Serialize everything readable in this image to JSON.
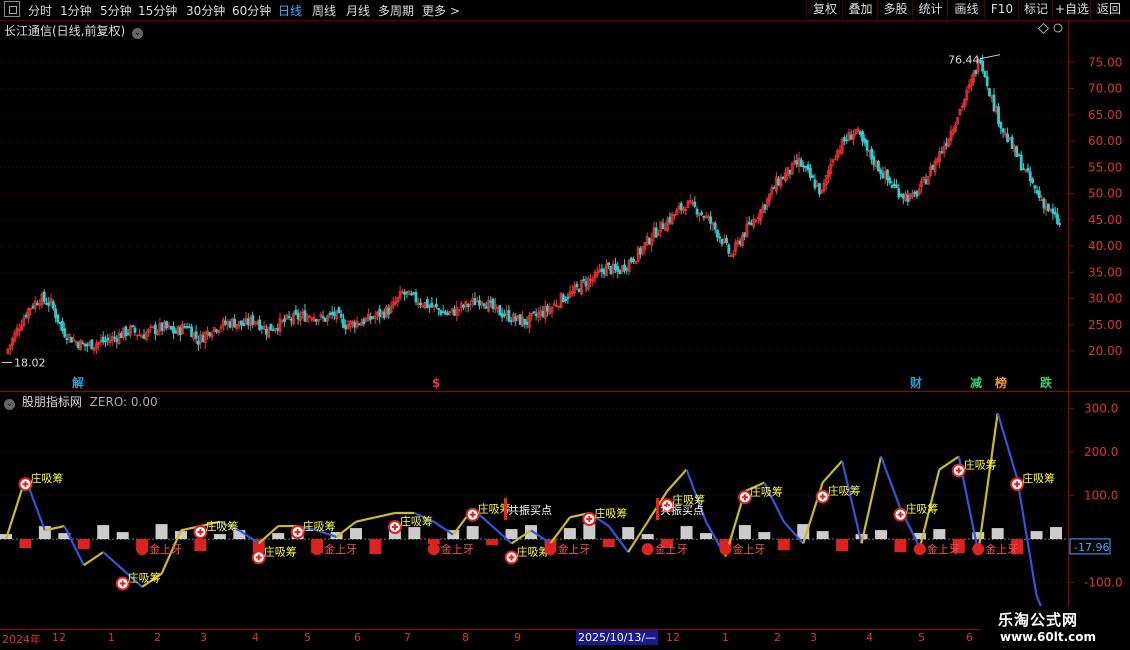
{
  "toolbar": {
    "items": [
      "分时",
      "1分钟",
      "5分钟",
      "15分钟",
      "30分钟",
      "60分钟",
      "日线",
      "周线",
      "月线",
      "多周期",
      "更多 >"
    ],
    "active_index": 6,
    "right_items": [
      "复权",
      "叠加",
      "多股",
      "统计",
      "画线",
      "F10",
      "标记",
      "+自选",
      "返回"
    ]
  },
  "main_chart": {
    "title": "长江通信(日线,前复权)",
    "price_high_label": "76.44",
    "price_low_label": "18.02",
    "y_ticks": [
      "75.00",
      "70.00",
      "65.00",
      "60.00",
      "55.00",
      "50.00",
      "45.00",
      "40.00",
      "35.00",
      "30.00",
      "25.00",
      "20.00"
    ],
    "markers": [
      {
        "text": "解",
        "color": "#39c"
      },
      {
        "text": "$",
        "color": "#e33"
      },
      {
        "text": "财",
        "color": "#39c"
      },
      {
        "text": "减",
        "color": "#3c7"
      },
      {
        "text": "榜",
        "color": "#e93"
      },
      {
        "text": "跌",
        "color": "#3c7"
      }
    ]
  },
  "indicator": {
    "title": "股朋指标网",
    "zero_label": "ZERO: 0.00",
    "current_value": "-17.96",
    "y_ticks": [
      "300.0",
      "200.0",
      "100.0",
      "-100.0"
    ],
    "labels": {
      "accumulate": "庄吸筹",
      "gold_bud": "金上牙",
      "bottom_point": "共振买点"
    }
  },
  "chart_data": {
    "type": "candlestick",
    "title": "长江通信(日线,前复权)",
    "ylim": [
      16,
      80
    ],
    "high": 76.44,
    "low": 18.02,
    "close_series_approx": [
      19.5,
      24,
      28,
      30,
      29,
      24,
      22,
      21,
      21.5,
      22,
      23,
      24,
      23,
      24,
      24.5,
      23.5,
      25,
      22,
      24,
      25,
      25.5,
      25,
      26,
      24,
      25,
      26,
      26.5,
      27,
      26,
      27,
      25,
      25.5,
      26,
      27,
      28,
      31,
      30,
      29,
      28,
      27,
      28,
      29,
      30,
      28,
      27,
      26,
      25.5,
      27,
      28,
      30,
      31,
      33,
      34,
      36,
      35,
      37,
      39,
      42,
      44,
      46,
      48,
      47,
      45,
      42,
      38,
      42,
      45,
      48,
      52,
      54,
      56,
      53,
      50,
      57,
      60,
      62,
      58,
      55,
      52,
      50,
      49,
      52,
      56,
      60,
      65,
      70,
      76,
      68,
      62,
      58,
      54,
      50,
      47,
      44
    ],
    "indicator_series_approx": [
      0,
      140,
      20,
      30,
      -60,
      -30,
      -70,
      -110,
      -80,
      20,
      30,
      40,
      20,
      -10,
      30,
      30,
      20,
      5,
      40,
      50,
      60,
      60,
      40,
      10,
      70,
      30,
      -10,
      20,
      -10,
      50,
      60,
      30,
      -30,
      40,
      110,
      160,
      40,
      -40,
      110,
      130,
      40,
      -10,
      130,
      180,
      -10,
      190,
      70,
      -20,
      160,
      190,
      -30,
      290,
      140,
      -130,
      -240
    ]
  },
  "time_axis": {
    "labels": [
      "2024年",
      "12",
      "1",
      "2",
      "3",
      "4",
      "5",
      "6",
      "7",
      "8",
      "9",
      "",
      "12",
      "1",
      "2",
      "3",
      "4",
      "5",
      "6"
    ],
    "date_box": "2025/10/13/—"
  },
  "watermark": {
    "line1": "乐淘公式网",
    "line2": "www.60lt.com"
  },
  "colors": {
    "up": "#e33",
    "down": "#3cc",
    "grid": "#500",
    "indicator_up": "#cb2",
    "indicator_down": "#35d",
    "label": "#ff4"
  }
}
